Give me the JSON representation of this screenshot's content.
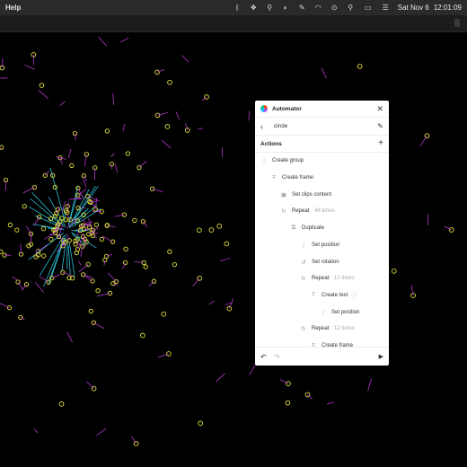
{
  "menubar": {
    "app_menu": "Help",
    "status_icons": [
      "bluetooth-icon",
      "dropbox-icon",
      "search-icon",
      "vpn-icon",
      "pen-icon",
      "wifi-icon",
      "vpn-lock-icon",
      "spotlight-icon",
      "battery-icon",
      "control-center-icon"
    ],
    "date": "Sat Nov 6",
    "time": "12:01:09"
  },
  "canvas": {
    "background": "#000000",
    "circle_color": "#e5e33a",
    "line_color": "#b137c9",
    "center_color": "#29c0d6"
  },
  "panel": {
    "title": "Automator",
    "automation_name": "circle",
    "actions_label": "Actions",
    "actions": [
      {
        "label": "Create group",
        "meta": "",
        "icon": "group-icon",
        "indent": 0
      },
      {
        "label": "Create frame",
        "meta": "",
        "icon": "frame-icon",
        "indent": 1
      },
      {
        "label": "Set clips content",
        "meta": "",
        "icon": "clips-icon",
        "indent": 2
      },
      {
        "label": "Repeat",
        "meta": "· 48 times",
        "icon": "repeat-icon",
        "indent": 2
      },
      {
        "label": "Duplicate",
        "meta": "",
        "icon": "duplicate-icon",
        "indent": 3
      },
      {
        "label": "Set position",
        "meta": "",
        "icon": "position-icon",
        "indent": 4
      },
      {
        "label": "Set rotation",
        "meta": "",
        "icon": "rotation-icon",
        "indent": 4
      },
      {
        "label": "Repeat",
        "meta": "· 12 times",
        "icon": "repeat-icon",
        "indent": 4
      },
      {
        "label": "Create text",
        "meta": "",
        "icon": "text-icon",
        "indent": 5,
        "info": "ⓘ"
      },
      {
        "label": "Set position",
        "meta": "",
        "icon": "position-icon",
        "indent": 6
      },
      {
        "label": "Repeat",
        "meta": "· 12 times",
        "icon": "repeat-icon",
        "indent": 4
      },
      {
        "label": "Create frame",
        "meta": "",
        "icon": "frame-icon",
        "indent": 5
      }
    ]
  }
}
